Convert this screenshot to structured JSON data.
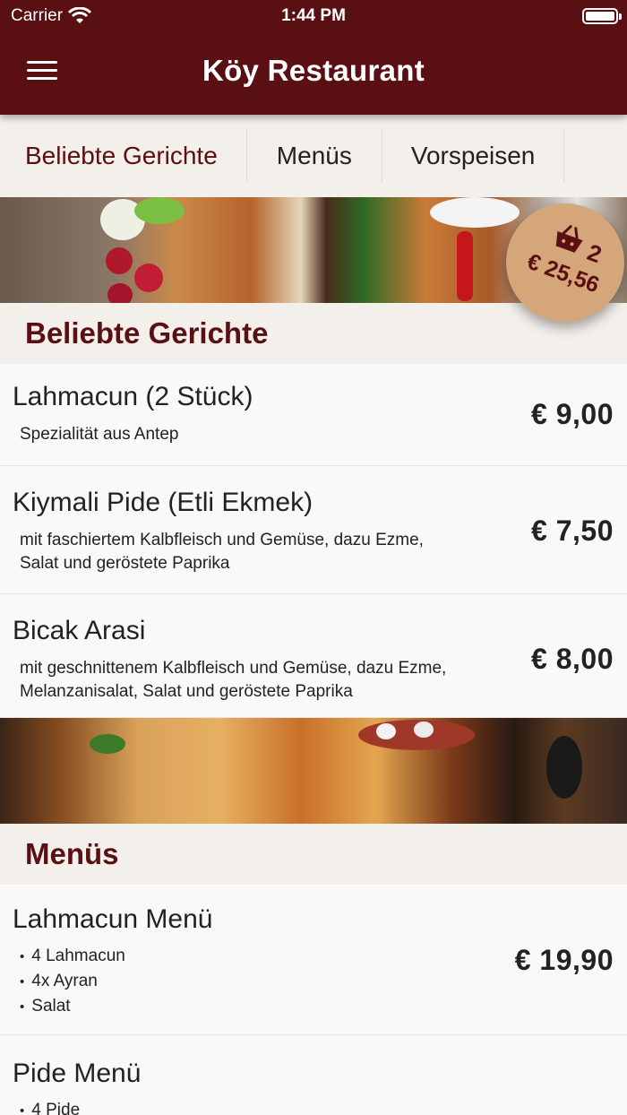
{
  "status_bar": {
    "carrier": "Carrier",
    "time": "1:44 PM"
  },
  "nav": {
    "title": "Köy Restaurant",
    "menu_icon": "hamburger-menu-icon"
  },
  "tabs": [
    {
      "label": "Beliebte Gerichte",
      "active": true
    },
    {
      "label": "Menüs",
      "active": false
    },
    {
      "label": "Vorspeisen",
      "active": false
    }
  ],
  "cart": {
    "count": "2",
    "total": "€ 25,56",
    "icon": "basket-icon"
  },
  "sections": [
    {
      "title": "Beliebte Gerichte",
      "items": [
        {
          "name": "Lahmacun (2 Stück)",
          "description": "Spezialität aus Antep",
          "price": "€ 9,00"
        },
        {
          "name": "Kiymali Pide (Etli Ekmek)",
          "description": "mit faschiertem Kalbfleisch und Gemüse, dazu Ezme, Salat und geröstete Paprika",
          "price": "€ 7,50"
        },
        {
          "name": "Bicak Arasi",
          "description": "mit geschnittenem Kalbfleisch und Gemüse, dazu Ezme, Melanzanisalat, Salat und geröstete Paprika",
          "price": "€ 8,00"
        }
      ]
    },
    {
      "title": "Menüs",
      "items": [
        {
          "name": "Lahmacun Menü",
          "bullets": [
            "4 Lahmacun",
            "4x Ayran",
            "Salat"
          ],
          "price": "€ 19,90"
        },
        {
          "name": "Pide Menü",
          "bullets": [
            "4 Pide"
          ]
        }
      ]
    }
  ],
  "colors": {
    "primary": "#5a1013",
    "cart_bg": "#d4a679",
    "section_bg": "#f3efea"
  }
}
